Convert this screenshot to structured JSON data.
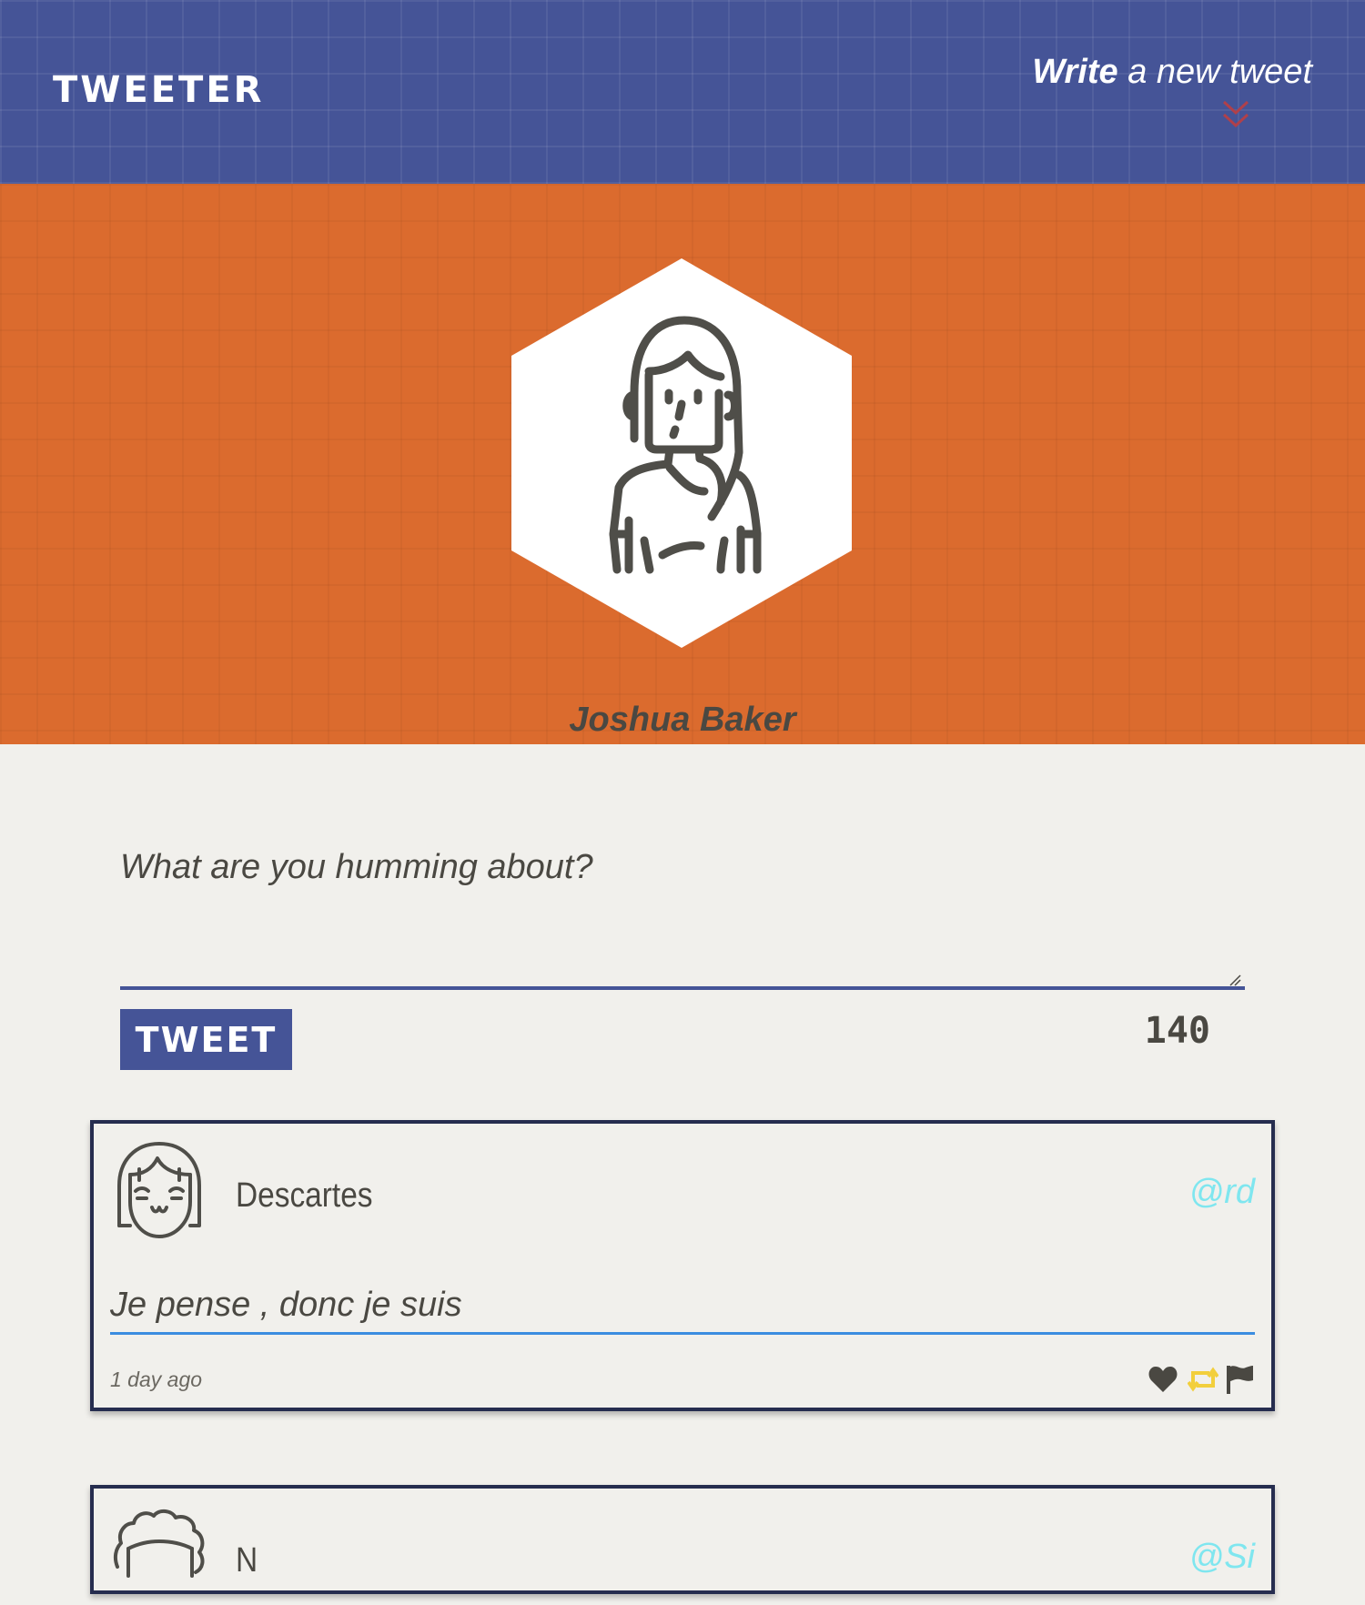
{
  "nav": {
    "brand": "TWEETER",
    "compose_toggle": {
      "bold_word": "Write",
      "rest": " a new tweet",
      "icon": "double-chevron-down-icon"
    }
  },
  "profile": {
    "first_name": "Joshua",
    "last_name": " Baker",
    "avatar_icon": "user-avatar-icon",
    "header_color": "#db6b2e"
  },
  "compose": {
    "placeholder": "What are you humming about?",
    "value": "",
    "submit_label": "TWEET",
    "char_count": "140"
  },
  "tweets": [
    {
      "name": "Descartes",
      "handle": "@rd",
      "text": "Je pense , donc je suis",
      "time": "1 day ago",
      "avatar_icon": "smiling-face-avatar-icon",
      "actions": [
        "heart-icon",
        "retweet-icon",
        "flag-icon"
      ]
    },
    {
      "name": "N",
      "handle": "@Si",
      "avatar_icon": "curly-hair-avatar-icon"
    }
  ],
  "colors": {
    "nav": "#455497",
    "accent_orange": "#db6b2e",
    "handle": "#7fe6ef",
    "retweet": "#f2cf3c",
    "text": "#4a4842",
    "page_bg": "#f1f0ec"
  }
}
